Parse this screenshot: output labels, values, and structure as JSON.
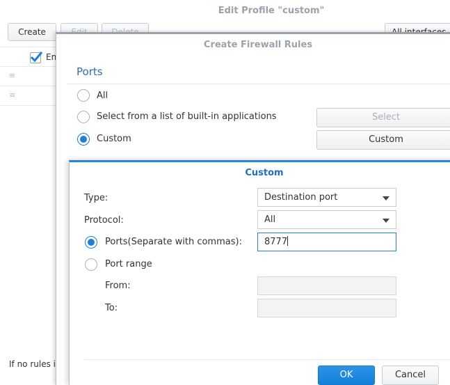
{
  "back_window": {
    "title": "Edit Profile \"custom\"",
    "toolbar": {
      "create": "Create",
      "edit": "Edit",
      "delete": "Delete",
      "interfaces": "All interfaces"
    },
    "column_enabled": "En",
    "footer_text": "If no rules i"
  },
  "rules_window": {
    "title": "Create Firewall Rules",
    "section": "Ports",
    "options": {
      "all": "All",
      "builtin": "Select from a list of built-in applications",
      "custom": "Custom"
    },
    "selected_option": "custom",
    "select_button": "Select",
    "custom_button": "Custom"
  },
  "custom_dialog": {
    "title": "Custom",
    "type_label": "Type:",
    "type_value": "Destination port",
    "protocol_label": "Protocol:",
    "protocol_value": "All",
    "ports_label": "Ports(Separate with commas):",
    "ports_value": "8777",
    "range_label": "Port range",
    "from_label": "From:",
    "to_label": "To:",
    "ok": "OK",
    "cancel": "Cancel"
  },
  "colors": {
    "accent": "#1f86d9",
    "section": "#2b6fb7",
    "title_muted": "#9aa3ad"
  }
}
